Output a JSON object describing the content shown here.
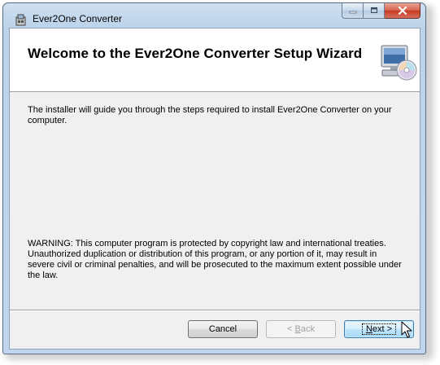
{
  "window": {
    "title": "Ever2One Converter",
    "icons": {
      "app": "installer-app-icon",
      "minimize": "minimize-icon",
      "maximize": "maximize-icon",
      "close": "close-icon"
    }
  },
  "banner": {
    "title": "Welcome to the Ever2One Converter Setup Wizard",
    "art_icon": "computer-cd-icon"
  },
  "content": {
    "intro": "The installer will guide you through the steps required to install Ever2One Converter on your computer.",
    "warning": "WARNING: This computer program is protected by copyright law and international treaties. Unauthorized duplication or distribution of this program, or any portion of it, may result in severe civil or criminal penalties, and will be prosecuted to the maximum extent possible under the law."
  },
  "buttons": {
    "cancel": "Cancel",
    "back_prefix": "< ",
    "back_key": "B",
    "back_rest": "ack",
    "next_key": "N",
    "next_rest": "ext >",
    "back_enabled": false
  },
  "cursor": "arrow-cursor-icon"
}
